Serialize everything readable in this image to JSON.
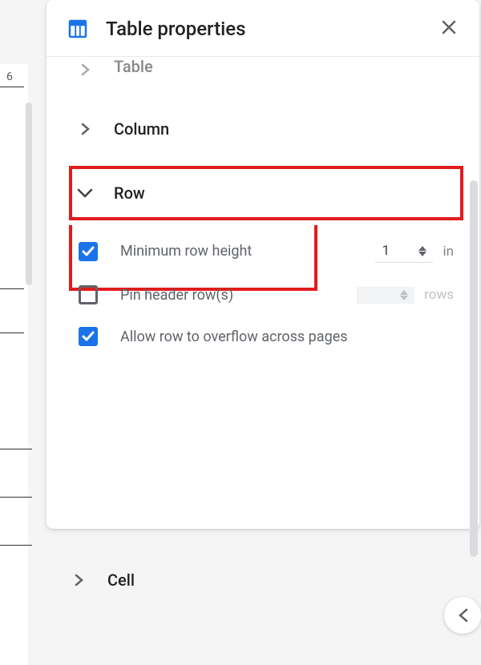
{
  "panel": {
    "title": "Table properties"
  },
  "ruler": {
    "mark": "6"
  },
  "sections": {
    "table": {
      "label": "Table"
    },
    "column": {
      "label": "Column"
    },
    "row": {
      "label": "Row"
    },
    "cell": {
      "label": "Cell"
    }
  },
  "row_options": {
    "min_height": {
      "label": "Minimum row height",
      "value": "1",
      "unit": "in",
      "checked": true
    },
    "pin_header": {
      "label": "Pin header row(s)",
      "unit": "rows",
      "checked": false
    },
    "overflow": {
      "label": "Allow row to overflow across pages",
      "checked": true
    }
  }
}
